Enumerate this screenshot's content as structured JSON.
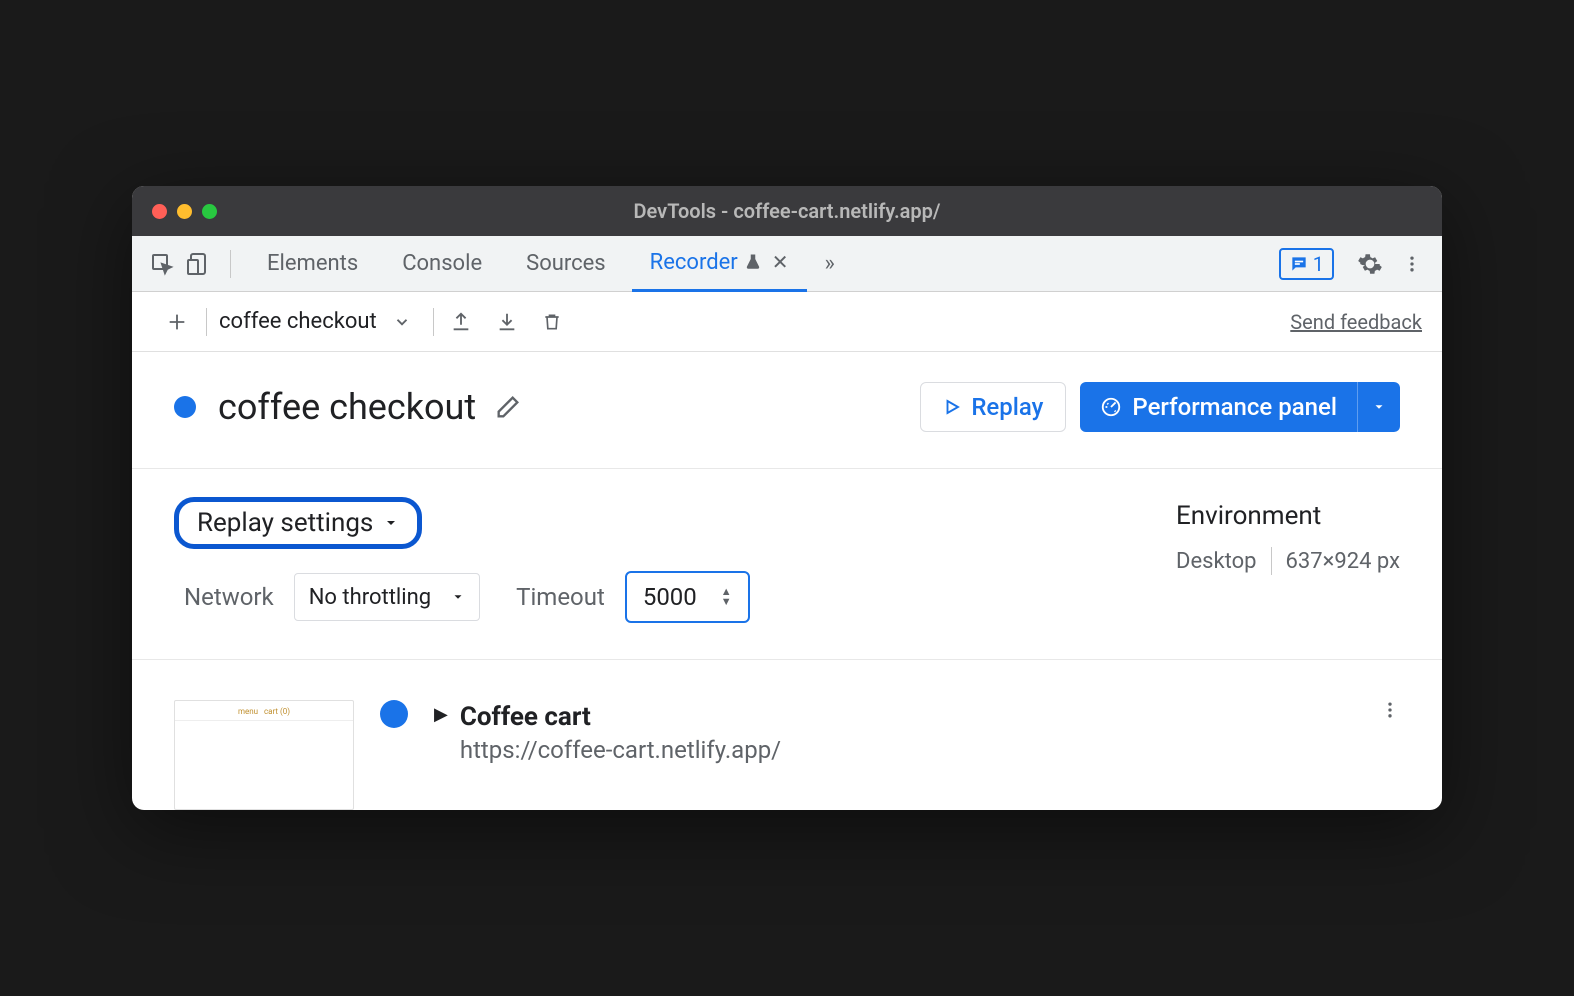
{
  "window": {
    "title": "DevTools - coffee-cart.netlify.app/"
  },
  "tabs": {
    "elements": "Elements",
    "console": "Console",
    "sources": "Sources",
    "recorder": "Recorder",
    "more": "»"
  },
  "feedback_count": "1",
  "subbar": {
    "recording_name": "coffee checkout",
    "send_feedback": "Send feedback"
  },
  "header": {
    "title": "coffee checkout",
    "replay_label": "Replay",
    "perf_label": "Performance panel"
  },
  "settings": {
    "replay_settings_label": "Replay settings",
    "network_label": "Network",
    "network_value": "No throttling",
    "timeout_label": "Timeout",
    "timeout_value": "5000",
    "env_title": "Environment",
    "env_device": "Desktop",
    "env_dims": "637×924 px"
  },
  "step": {
    "title": "Coffee cart",
    "url": "https://coffee-cart.netlify.app/"
  }
}
